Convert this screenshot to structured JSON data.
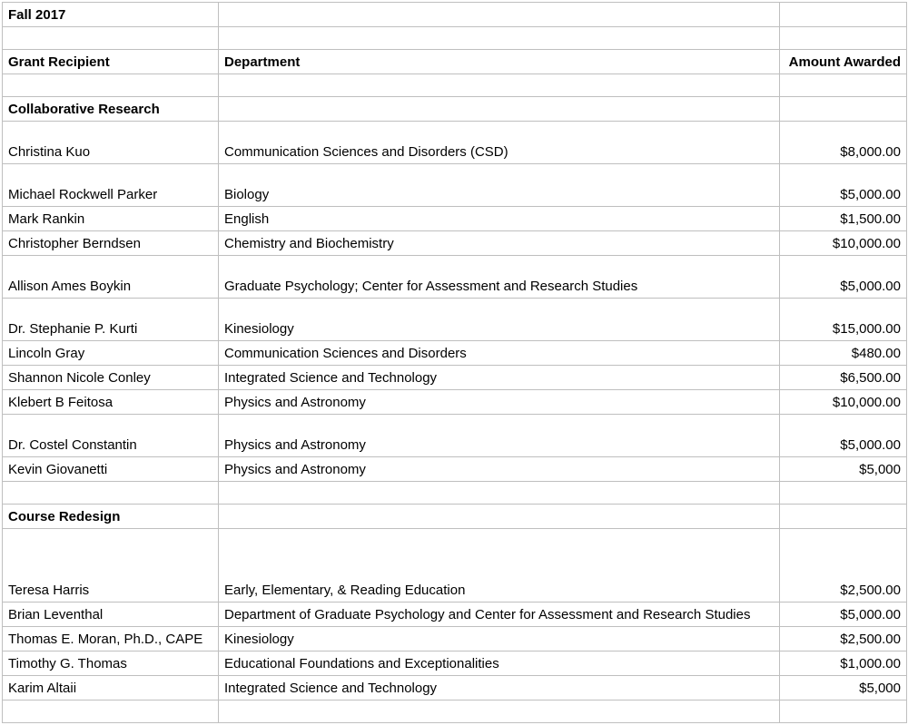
{
  "title": "Fall 2017",
  "headers": {
    "recipient": "Grant Recipient",
    "department": "Department",
    "amount": "Amount Awarded"
  },
  "sections": {
    "collab": "Collaborative Research",
    "course": "Course Redesign"
  },
  "rows": {
    "r0": {
      "name": "Christina Kuo",
      "dept": "Communication Sciences and Disorders (CSD)",
      "amount": "$8,000.00"
    },
    "r1": {
      "name": "Michael Rockwell Parker",
      "dept": "Biology",
      "amount": "$5,000.00"
    },
    "r2": {
      "name": "Mark Rankin",
      "dept": "English",
      "amount": "$1,500.00"
    },
    "r3": {
      "name": "Christopher Berndsen",
      "dept": "Chemistry and Biochemistry",
      "amount": "$10,000.00"
    },
    "r4": {
      "name": "Allison Ames Boykin",
      "dept": "Graduate Psychology; Center for Assessment and Research Studies",
      "amount": "$5,000.00"
    },
    "r5": {
      "name": "Dr. Stephanie P. Kurti",
      "dept": "Kinesiology",
      "amount": "$15,000.00"
    },
    "r6": {
      "name": "Lincoln Gray",
      "dept": "Communication Sciences and Disorders",
      "amount": "$480.00"
    },
    "r7": {
      "name": "Shannon Nicole Conley",
      "dept": "Integrated Science and Technology",
      "amount": "$6,500.00"
    },
    "r8": {
      "name": "Klebert B Feitosa",
      "dept": "Physics and Astronomy",
      "amount": "$10,000.00"
    },
    "r9": {
      "name": "Dr. Costel Constantin",
      "dept": "Physics and Astronomy",
      "amount": "$5,000.00"
    },
    "r10": {
      "name": "Kevin Giovanetti",
      "dept": "Physics and Astronomy",
      "amount": "$5,000"
    },
    "r11": {
      "name": "Teresa Harris",
      "dept": "Early, Elementary, & Reading Education",
      "amount": "$2,500.00"
    },
    "r12": {
      "name": "Brian Leventhal",
      "dept": "Department of Graduate Psychology and Center for Assessment and Research Studies",
      "amount": "$5,000.00"
    },
    "r13": {
      "name": "Thomas E. Moran, Ph.D., CAPE",
      "dept": "Kinesiology",
      "amount": "$2,500.00"
    },
    "r14": {
      "name": "Timothy G. Thomas",
      "dept": "Educational Foundations and Exceptionalities",
      "amount": "$1,000.00"
    },
    "r15": {
      "name": "Karim Altaii",
      "dept": "Integrated Science and Technology",
      "amount": "$5,000"
    }
  }
}
